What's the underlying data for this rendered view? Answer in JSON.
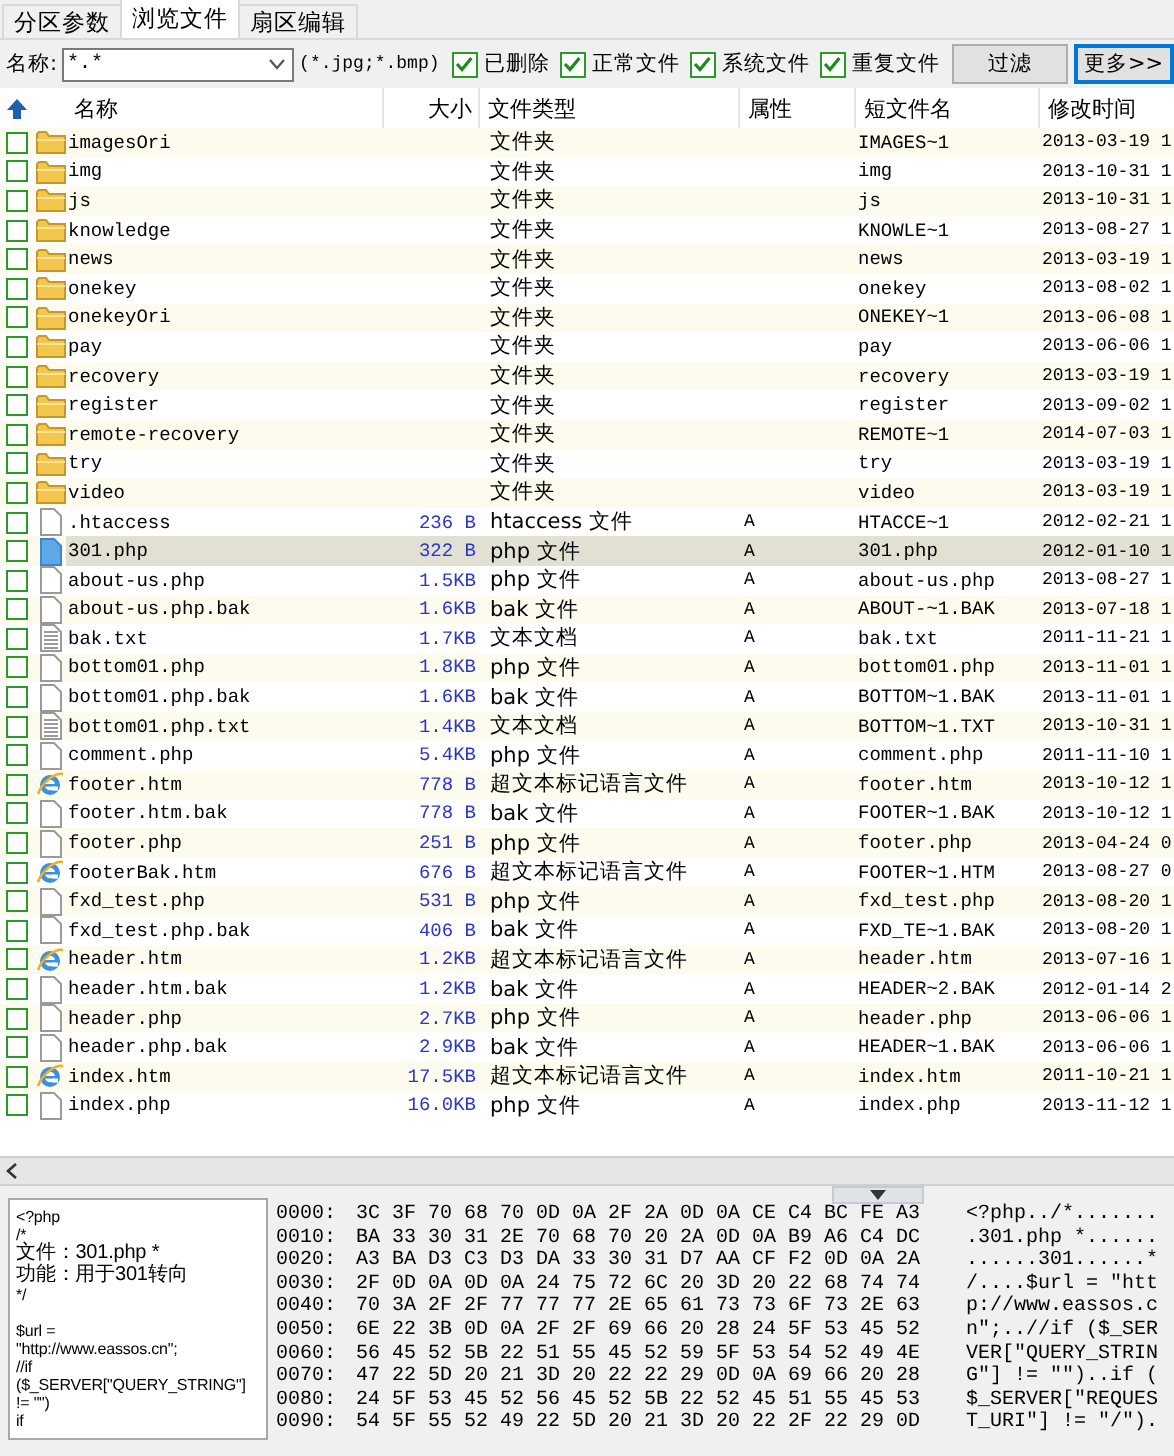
{
  "tabs": [
    {
      "label": "分区参数",
      "selected": false
    },
    {
      "label": "浏览文件",
      "selected": true
    },
    {
      "label": "扇区编辑",
      "selected": false
    }
  ],
  "filter": {
    "label": "名称:",
    "value": "*.*",
    "hint": "(*.jpg;*.bmp)",
    "options": [
      {
        "label": "已删除",
        "checked": true
      },
      {
        "label": "正常文件",
        "checked": true
      },
      {
        "label": "系统文件",
        "checked": true
      },
      {
        "label": "重复文件",
        "checked": true
      }
    ],
    "buttons": [
      {
        "label": "过滤",
        "focused": false
      },
      {
        "label": "更多>>",
        "focused": true
      }
    ]
  },
  "table": {
    "columns": [
      "名称",
      "大小",
      "文件类型",
      "属性",
      "短文件名",
      "修改时间"
    ],
    "rows": [
      {
        "kind": "folder",
        "checked": false,
        "selected": false,
        "name": "imagesOri",
        "size": "",
        "type": "文件夹",
        "attr": "",
        "short": "IMAGES~1",
        "modified": "2013-03-19 1"
      },
      {
        "kind": "folder",
        "checked": false,
        "selected": false,
        "name": "img",
        "size": "",
        "type": "文件夹",
        "attr": "",
        "short": "img",
        "modified": "2013-10-31 1"
      },
      {
        "kind": "folder",
        "checked": false,
        "selected": false,
        "name": "js",
        "size": "",
        "type": "文件夹",
        "attr": "",
        "short": "js",
        "modified": "2013-10-31 1"
      },
      {
        "kind": "folder",
        "checked": false,
        "selected": false,
        "name": "knowledge",
        "size": "",
        "type": "文件夹",
        "attr": "",
        "short": "KNOWLE~1",
        "modified": "2013-08-27 1"
      },
      {
        "kind": "folder",
        "checked": false,
        "selected": false,
        "name": "news",
        "size": "",
        "type": "文件夹",
        "attr": "",
        "short": "news",
        "modified": "2013-03-19 1"
      },
      {
        "kind": "folder",
        "checked": false,
        "selected": false,
        "name": "onekey",
        "size": "",
        "type": "文件夹",
        "attr": "",
        "short": "onekey",
        "modified": "2013-08-02 1"
      },
      {
        "kind": "folder",
        "checked": false,
        "selected": false,
        "name": "onekeyOri",
        "size": "",
        "type": "文件夹",
        "attr": "",
        "short": "ONEKEY~1",
        "modified": "2013-06-08 1"
      },
      {
        "kind": "folder",
        "checked": false,
        "selected": false,
        "name": "pay",
        "size": "",
        "type": "文件夹",
        "attr": "",
        "short": "pay",
        "modified": "2013-06-06 1"
      },
      {
        "kind": "folder",
        "checked": false,
        "selected": false,
        "name": "recovery",
        "size": "",
        "type": "文件夹",
        "attr": "",
        "short": "recovery",
        "modified": "2013-03-19 1"
      },
      {
        "kind": "folder",
        "checked": false,
        "selected": false,
        "name": "register",
        "size": "",
        "type": "文件夹",
        "attr": "",
        "short": "register",
        "modified": "2013-09-02 1"
      },
      {
        "kind": "folder",
        "checked": false,
        "selected": false,
        "name": "remote-recovery",
        "size": "",
        "type": "文件夹",
        "attr": "",
        "short": "REMOTE~1",
        "modified": "2014-07-03 1"
      },
      {
        "kind": "folder",
        "checked": false,
        "selected": false,
        "name": "try",
        "size": "",
        "type": "文件夹",
        "attr": "",
        "short": "try",
        "modified": "2013-03-19 1"
      },
      {
        "kind": "folder",
        "checked": false,
        "selected": false,
        "name": "video",
        "size": "",
        "type": "文件夹",
        "attr": "",
        "short": "video",
        "modified": "2013-03-19 1"
      },
      {
        "kind": "file",
        "checked": false,
        "selected": false,
        "name": ".htaccess",
        "size": "236 B",
        "type": "htaccess 文件",
        "attr": "A",
        "short": "HTACCE~1",
        "modified": "2012-02-21 1"
      },
      {
        "kind": "file",
        "checked": false,
        "selected": true,
        "name": "301.php",
        "size": "322 B",
        "type": "php 文件",
        "attr": "A",
        "short": "301.php",
        "modified": "2012-01-10 1"
      },
      {
        "kind": "file",
        "checked": false,
        "selected": false,
        "name": "about-us.php",
        "size": "1.5KB",
        "type": "php 文件",
        "attr": "A",
        "short": "about-us.php",
        "modified": "2013-08-27 1"
      },
      {
        "kind": "file",
        "checked": false,
        "selected": false,
        "name": "about-us.php.bak",
        "size": "1.6KB",
        "type": "bak 文件",
        "attr": "A",
        "short": "ABOUT-~1.BAK",
        "modified": "2013-07-18 1"
      },
      {
        "kind": "text",
        "checked": false,
        "selected": false,
        "name": "bak.txt",
        "size": "1.7KB",
        "type": "文本文档",
        "attr": "A",
        "short": "bak.txt",
        "modified": "2011-11-21 1"
      },
      {
        "kind": "file",
        "checked": false,
        "selected": false,
        "name": "bottom01.php",
        "size": "1.8KB",
        "type": "php 文件",
        "attr": "A",
        "short": "bottom01.php",
        "modified": "2013-11-01 1"
      },
      {
        "kind": "file",
        "checked": false,
        "selected": false,
        "name": "bottom01.php.bak",
        "size": "1.6KB",
        "type": "bak 文件",
        "attr": "A",
        "short": "BOTTOM~1.BAK",
        "modified": "2013-11-01 1"
      },
      {
        "kind": "text",
        "checked": false,
        "selected": false,
        "name": "bottom01.php.txt",
        "size": "1.4KB",
        "type": "文本文档",
        "attr": "A",
        "short": "BOTTOM~1.TXT",
        "modified": "2013-10-31 1"
      },
      {
        "kind": "file",
        "checked": false,
        "selected": false,
        "name": "comment.php",
        "size": "5.4KB",
        "type": "php 文件",
        "attr": "A",
        "short": "comment.php",
        "modified": "2011-11-10 1"
      },
      {
        "kind": "web",
        "checked": false,
        "selected": false,
        "name": "footer.htm",
        "size": "778 B",
        "type": "超文本标记语言文件",
        "attr": "A",
        "short": "footer.htm",
        "modified": "2013-10-12 1"
      },
      {
        "kind": "file",
        "checked": false,
        "selected": false,
        "name": "footer.htm.bak",
        "size": "778 B",
        "type": "bak 文件",
        "attr": "A",
        "short": "FOOTER~1.BAK",
        "modified": "2013-10-12 1"
      },
      {
        "kind": "file",
        "checked": false,
        "selected": false,
        "name": "footer.php",
        "size": "251 B",
        "type": "php 文件",
        "attr": "A",
        "short": "footer.php",
        "modified": "2013-04-24 0"
      },
      {
        "kind": "web",
        "checked": false,
        "selected": false,
        "name": "footerBak.htm",
        "size": "676 B",
        "type": "超文本标记语言文件",
        "attr": "A",
        "short": "FOOTER~1.HTM",
        "modified": "2013-08-27 0"
      },
      {
        "kind": "file",
        "checked": false,
        "selected": false,
        "name": "fxd_test.php",
        "size": "531 B",
        "type": "php 文件",
        "attr": "A",
        "short": "fxd_test.php",
        "modified": "2013-08-20 1"
      },
      {
        "kind": "file",
        "checked": false,
        "selected": false,
        "name": "fxd_test.php.bak",
        "size": "406 B",
        "type": "bak 文件",
        "attr": "A",
        "short": "FXD_TE~1.BAK",
        "modified": "2013-08-20 1"
      },
      {
        "kind": "web",
        "checked": false,
        "selected": false,
        "name": "header.htm",
        "size": "1.2KB",
        "type": "超文本标记语言文件",
        "attr": "A",
        "short": "header.htm",
        "modified": "2013-07-16 1"
      },
      {
        "kind": "file",
        "checked": false,
        "selected": false,
        "name": "header.htm.bak",
        "size": "1.2KB",
        "type": "bak 文件",
        "attr": "A",
        "short": "HEADER~2.BAK",
        "modified": "2012-01-14 2"
      },
      {
        "kind": "file",
        "checked": false,
        "selected": false,
        "name": "header.php",
        "size": "2.7KB",
        "type": "php 文件",
        "attr": "A",
        "short": "header.php",
        "modified": "2013-06-06 1"
      },
      {
        "kind": "file",
        "checked": false,
        "selected": false,
        "name": "header.php.bak",
        "size": "2.9KB",
        "type": "bak 文件",
        "attr": "A",
        "short": "HEADER~1.BAK",
        "modified": "2013-06-06 1"
      },
      {
        "kind": "web",
        "checked": false,
        "selected": false,
        "name": "index.htm",
        "size": "17.5KB",
        "type": "超文本标记语言文件",
        "attr": "A",
        "short": "index.htm",
        "modified": "2011-10-21 1"
      },
      {
        "kind": "file",
        "checked": false,
        "selected": false,
        "name": "index.php",
        "size": "16.0KB",
        "type": "php 文件",
        "attr": "A",
        "short": "index.php",
        "modified": "2013-11-12 1"
      }
    ]
  },
  "preview": {
    "text": "<?php\n/*\n文件：301.php *\n功能：用于301转向\n*/\n\n$url =\n\"http://www.eassos.cn\";\n//if\n($_SERVER[\"QUERY_STRING\"]\n!= \"\")\nif"
  },
  "hex_view": {
    "rows": [
      {
        "offset": "0000:",
        "bytes": "3C 3F 70 68 70 0D 0A 2F 2A 0D 0A CE C4 BC FE A3",
        "ascii": "<?php../*......."
      },
      {
        "offset": "0010:",
        "bytes": "BA 33 30 31 2E 70 68 70 20 2A 0D 0A B9 A6 C4 DC",
        "ascii": ".301.php *......"
      },
      {
        "offset": "0020:",
        "bytes": "A3 BA D3 C3 D3 DA 33 30 31 D7 AA CF F2 0D 0A 2A",
        "ascii": "......301......*"
      },
      {
        "offset": "0030:",
        "bytes": "2F 0D 0A 0D 0A 24 75 72 6C 20 3D 20 22 68 74 74",
        "ascii": "/....$url = \"htt"
      },
      {
        "offset": "0040:",
        "bytes": "70 3A 2F 2F 77 77 77 2E 65 61 73 73 6F 73 2E 63",
        "ascii": "p://www.eassos.c"
      },
      {
        "offset": "0050:",
        "bytes": "6E 22 3B 0D 0A 2F 2F 69 66 20 28 24 5F 53 45 52",
        "ascii": "n\";..//if ($_SER"
      },
      {
        "offset": "0060:",
        "bytes": "56 45 52 5B 22 51 55 45 52 59 5F 53 54 52 49 4E",
        "ascii": "VER[\"QUERY_STRIN"
      },
      {
        "offset": "0070:",
        "bytes": "47 22 5D 20 21 3D 20 22 22 29 0D 0A 69 66 20 28",
        "ascii": "G\"] != \"\")..if ("
      },
      {
        "offset": "0080:",
        "bytes": "24 5F 53 45 52 56 45 52 5B 22 52 45 51 55 45 53",
        "ascii": "$_SERVER[\"REQUES"
      },
      {
        "offset": "0090:",
        "bytes": "54 5F 55 52 49 22 5D 20 21 3D 20 22 2F 22 29 0D",
        "ascii": "T_URI\"] != \"/\")."
      }
    ]
  }
}
